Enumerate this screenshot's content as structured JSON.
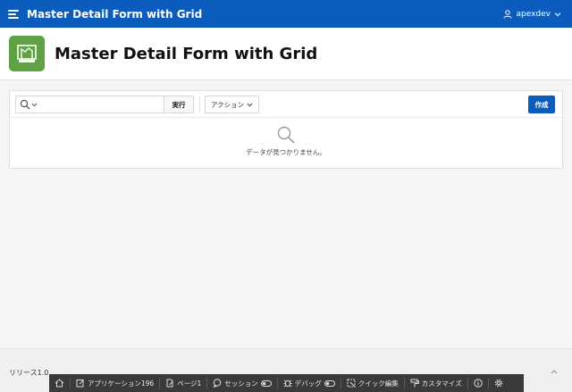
{
  "header": {
    "app_title": "Master Detail Form with Grid",
    "user_name": "apexdev"
  },
  "page": {
    "title": "Master Detail Form with Grid"
  },
  "report": {
    "search_value": "",
    "go_label": "実行",
    "actions_label": "アクション",
    "create_label": "作成",
    "empty_message": "データが見つかりません。"
  },
  "footer": {
    "release": "リリース1.0"
  },
  "devbar": {
    "home": "",
    "application": "アプリケーション196",
    "page": "ページ1",
    "session": "セッション",
    "debug": "デバッグ",
    "quick_edit": "クイック編集",
    "customize": "カスタマイズ"
  },
  "colors": {
    "header_bg": "#0b5cbd",
    "app_icon_bg": "#5fa244",
    "primary_button": "#0b5cbd",
    "devbar_bg": "#3a3a3a"
  }
}
